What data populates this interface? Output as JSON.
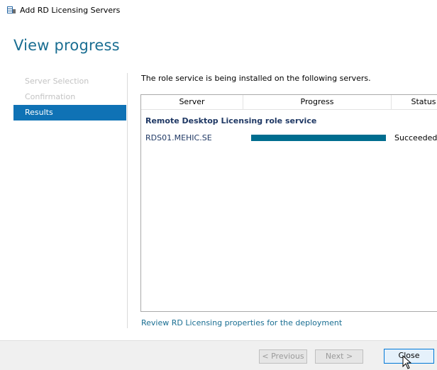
{
  "window": {
    "title": "Add RD Licensing Servers",
    "icon": "server-app-icon"
  },
  "page": {
    "heading": "View progress"
  },
  "nav": {
    "items": [
      {
        "label": "Server Selection",
        "state": "disabled"
      },
      {
        "label": "Confirmation",
        "state": "disabled"
      },
      {
        "label": "Results",
        "state": "active"
      }
    ]
  },
  "main": {
    "intro": "The role service is being installed on the following servers.",
    "table": {
      "columns": [
        "Server",
        "Progress",
        "Status"
      ],
      "group_title": "Remote Desktop Licensing role service",
      "rows": [
        {
          "server": "RDS01.MEHIC.SE",
          "progress_percent": 100,
          "status": "Succeeded"
        }
      ]
    },
    "link": "Review RD Licensing properties for the deployment"
  },
  "footer": {
    "prev_label": "< Previous",
    "next_label": "Next >",
    "close_label": "Close"
  },
  "colors": {
    "accent": "#1a6e92",
    "nav_active": "#0f72b5",
    "progress_fill": "#006d8f"
  }
}
